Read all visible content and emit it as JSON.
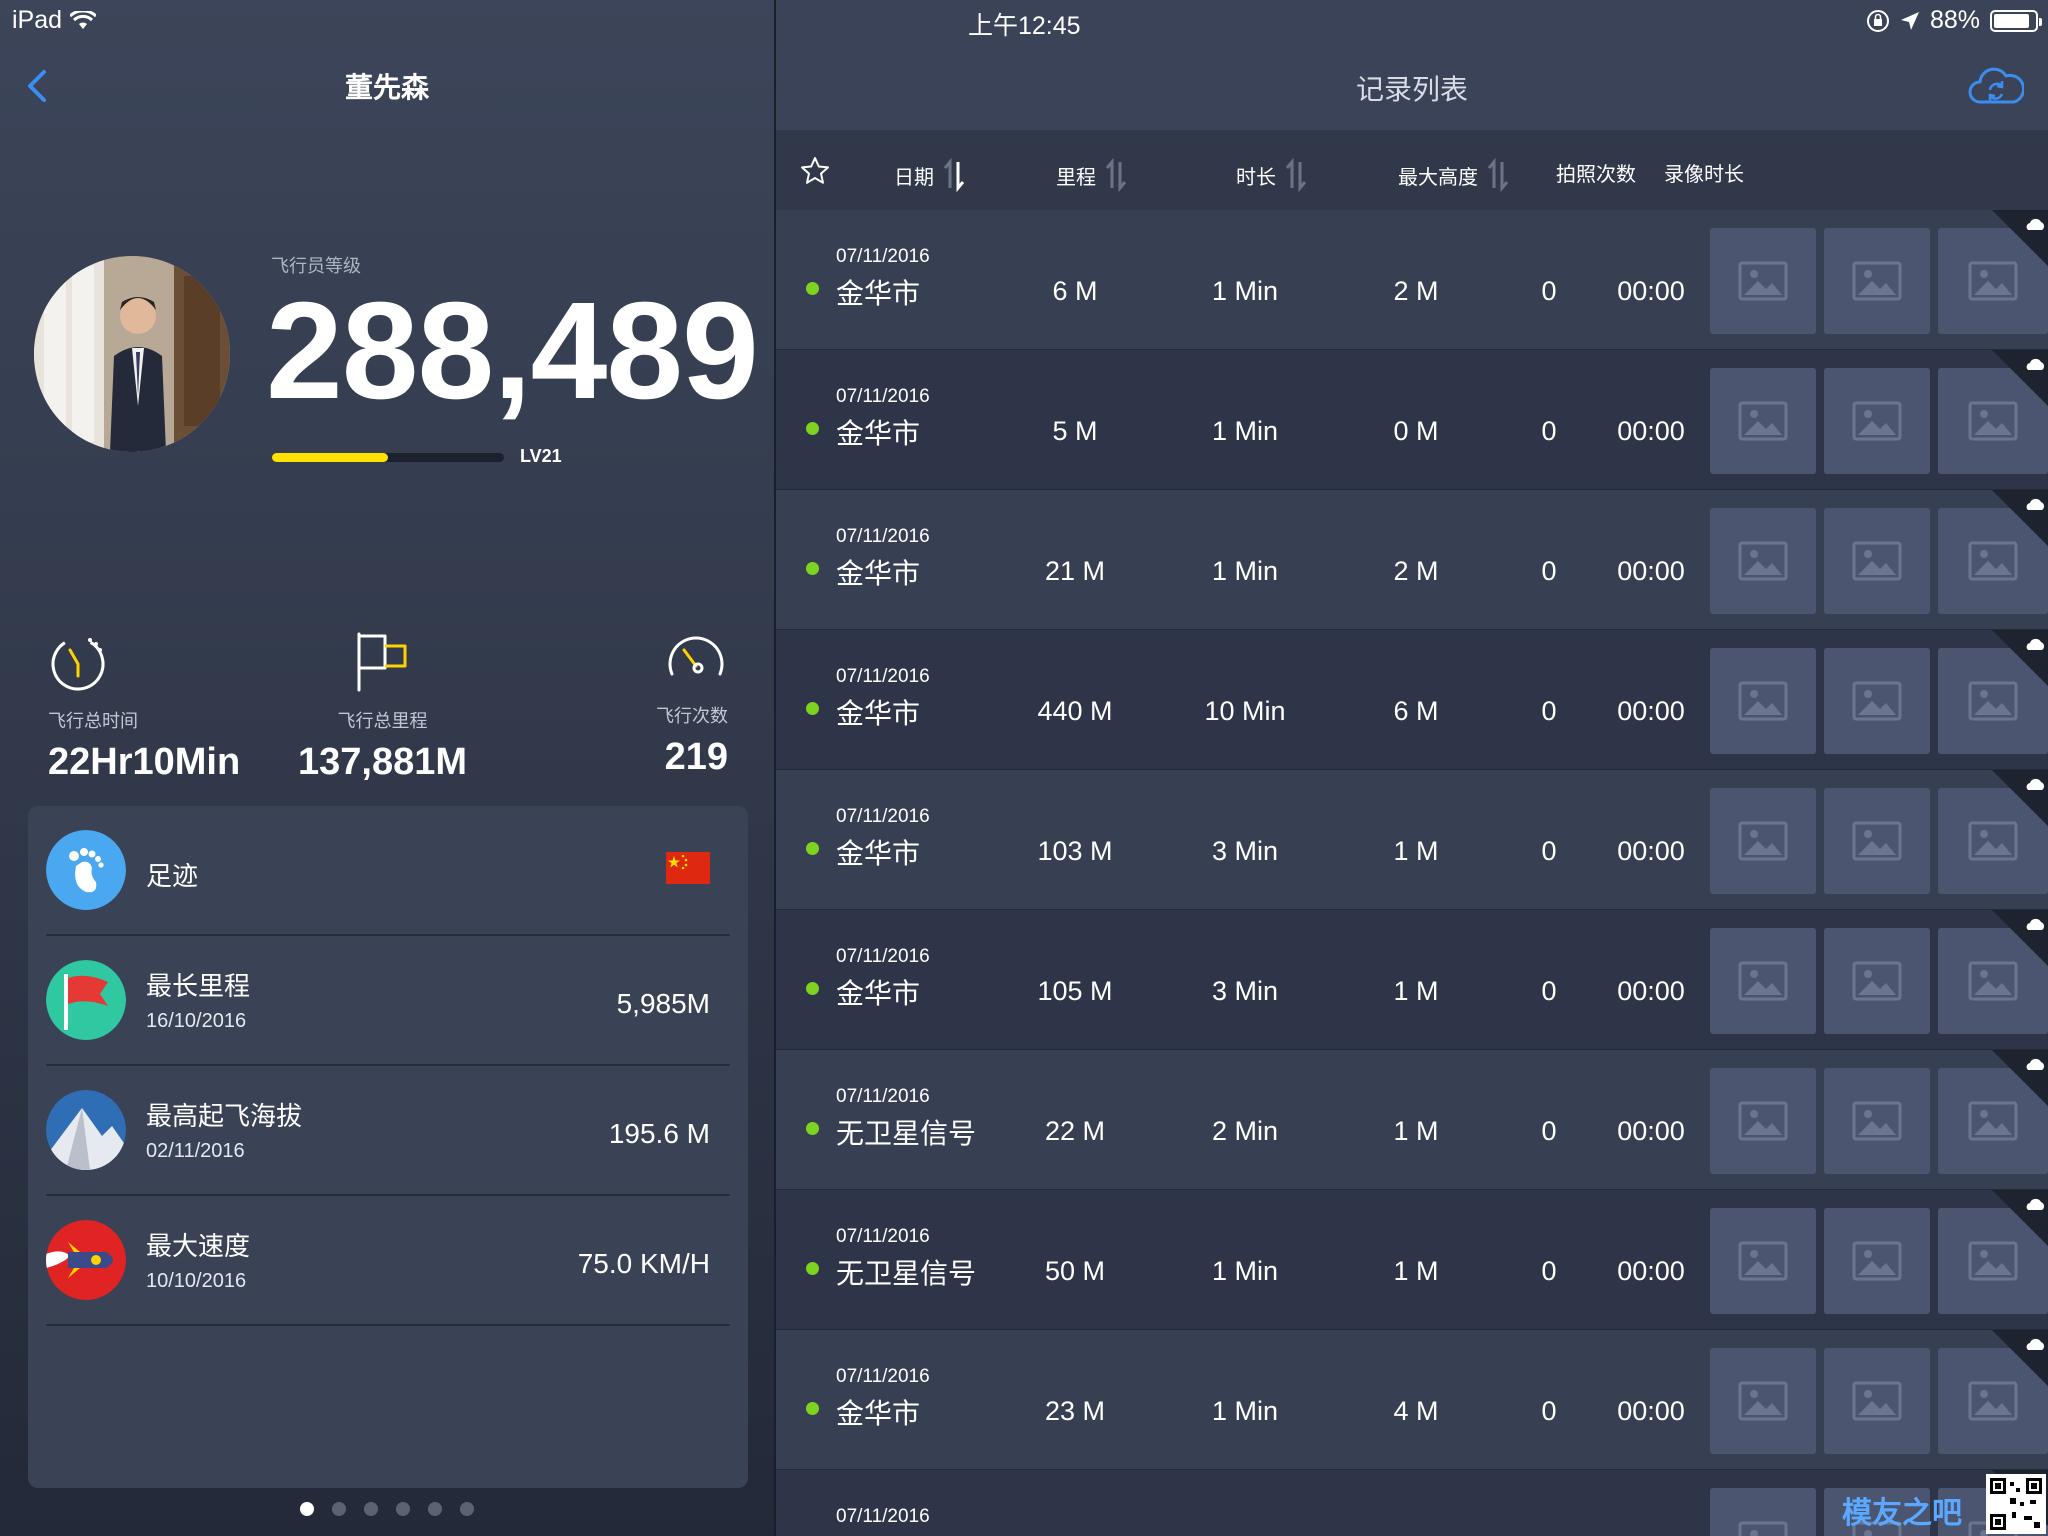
{
  "status_bar": {
    "device": "iPad",
    "time": "上午12:45",
    "battery": "88%",
    "battery_level": 0.88
  },
  "profile": {
    "name": "董先森",
    "level_label": "飞行员等级",
    "score": "288,489",
    "level": "LV21",
    "level_progress": 0.5
  },
  "stats": [
    {
      "icon": "stopwatch-icon",
      "label": "飞行总时间",
      "value": "22Hr10Min"
    },
    {
      "icon": "flag-icon",
      "label": "飞行总里程",
      "value": "137,881M"
    },
    {
      "icon": "speedometer-icon",
      "label": "飞行次数",
      "value": "219"
    }
  ],
  "records": [
    {
      "icon": "footprint-icon",
      "title": "足迹",
      "date": "",
      "value": "",
      "color": "#4aa8f0"
    },
    {
      "icon": "red-flag-icon",
      "title": "最长里程",
      "date": "16/10/2016",
      "value": "5,985M",
      "color": "#2fc8a0"
    },
    {
      "icon": "mountain-icon",
      "title": "最高起飞海拔",
      "date": "02/11/2016",
      "value": "195.6 M",
      "color": "#2f6db5"
    },
    {
      "icon": "rocket-icon",
      "title": "最大速度",
      "date": "10/10/2016",
      "value": "75.0 KM/H",
      "color": "#e02424"
    }
  ],
  "pager": {
    "count": 6,
    "active": 0
  },
  "right": {
    "title": "记录列表",
    "columns": {
      "date": "日期",
      "distance": "里程",
      "duration": "时长",
      "max_altitude": "最大高度",
      "photos": "拍照次数",
      "video": "录像时长"
    },
    "flights": [
      {
        "date": "07/11/2016",
        "place": "金华市",
        "distance": "6 M",
        "duration": "1 Min",
        "altitude": "2 M",
        "photos": "0",
        "video": "00:00"
      },
      {
        "date": "07/11/2016",
        "place": "金华市",
        "distance": "5 M",
        "duration": "1 Min",
        "altitude": "0 M",
        "photos": "0",
        "video": "00:00"
      },
      {
        "date": "07/11/2016",
        "place": "金华市",
        "distance": "21 M",
        "duration": "1 Min",
        "altitude": "2 M",
        "photos": "0",
        "video": "00:00"
      },
      {
        "date": "07/11/2016",
        "place": "金华市",
        "distance": "440 M",
        "duration": "10 Min",
        "altitude": "6 M",
        "photos": "0",
        "video": "00:00"
      },
      {
        "date": "07/11/2016",
        "place": "金华市",
        "distance": "103 M",
        "duration": "3 Min",
        "altitude": "1 M",
        "photos": "0",
        "video": "00:00"
      },
      {
        "date": "07/11/2016",
        "place": "金华市",
        "distance": "105 M",
        "duration": "3 Min",
        "altitude": "1 M",
        "photos": "0",
        "video": "00:00"
      },
      {
        "date": "07/11/2016",
        "place": "无卫星信号",
        "distance": "22 M",
        "duration": "2 Min",
        "altitude": "1 M",
        "photos": "0",
        "video": "00:00"
      },
      {
        "date": "07/11/2016",
        "place": "无卫星信号",
        "distance": "50 M",
        "duration": "1 Min",
        "altitude": "1 M",
        "photos": "0",
        "video": "00:00"
      },
      {
        "date": "07/11/2016",
        "place": "金华市",
        "distance": "23 M",
        "duration": "1 Min",
        "altitude": "4 M",
        "photos": "0",
        "video": "00:00"
      },
      {
        "date": "07/11/2016",
        "place": "",
        "distance": "",
        "duration": "",
        "altitude": "",
        "photos": "",
        "video": ""
      }
    ]
  },
  "watermark": {
    "text": "模友之吧"
  }
}
